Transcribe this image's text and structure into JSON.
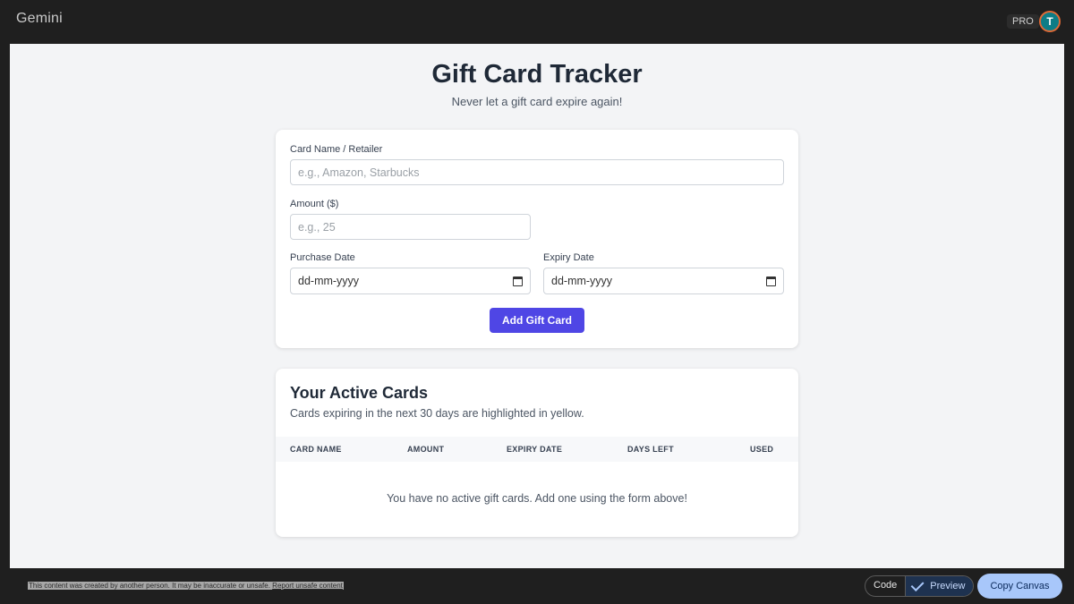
{
  "topbar": {
    "brand": "Gemini",
    "pro_badge": "PRO",
    "avatar_letter": "T"
  },
  "app": {
    "title": "Gift Card Tracker",
    "subtitle": "Never let a gift card expire again!"
  },
  "form": {
    "card_name_label": "Card Name / Retailer",
    "card_name_placeholder": "e.g., Amazon, Starbucks",
    "amount_label": "Amount ($)",
    "amount_placeholder": "e.g., 25",
    "purchase_date_label": "Purchase Date",
    "purchase_date_value": "dd-mm-yyyy",
    "expiry_date_label": "Expiry Date",
    "expiry_date_value": "dd-mm-yyyy",
    "submit_label": "Add Gift Card"
  },
  "cards": {
    "title": "Your Active Cards",
    "subtitle": "Cards expiring in the next 30 days are highlighted in yellow.",
    "columns": [
      "CARD NAME",
      "AMOUNT",
      "EXPIRY DATE",
      "DAYS LEFT",
      "USED"
    ],
    "empty_message": "You have no active gift cards. Add one using the form above!"
  },
  "bottombar": {
    "disclaimer": "This content was created by another person. It may be inaccurate or unsafe.",
    "report_link": "Report unsafe content",
    "code_label": "Code",
    "preview_label": "Preview",
    "copy_label": "Copy Canvas"
  },
  "colors": {
    "accent": "#4f46e5",
    "copy_button": "#a8c7fa",
    "avatar": "#0e7c86"
  }
}
